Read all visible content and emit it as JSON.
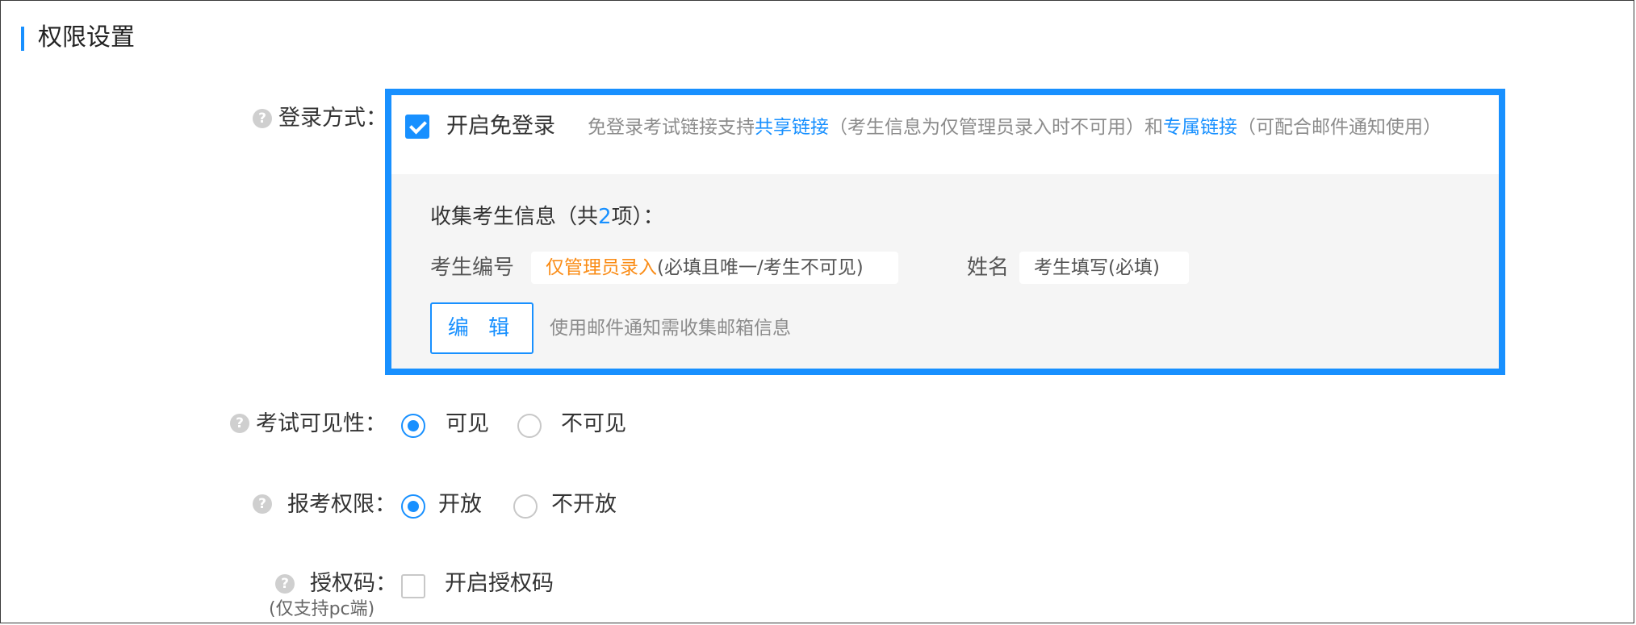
{
  "section": {
    "title": "权限设置"
  },
  "colors": {
    "accent": "#1890ff",
    "orange": "#fa8c16",
    "panel_bg": "#f5f5f5"
  },
  "login": {
    "label": "登录方式：",
    "checkbox_label": "开启免登录",
    "checked": true,
    "hint": {
      "part1": "免登录考试链接支持",
      "link1": "共享链接",
      "part2": "（考生信息为仅管理员录入时不可用）和",
      "link2": "专属链接",
      "part3": "（可配合邮件通知使用）"
    },
    "collect": {
      "title_prefix": "收集考生信息（共",
      "count": "2",
      "title_suffix": "项）：",
      "fields": [
        {
          "label": "考生编号",
          "value_accent": "仅管理员录入",
          "value_rest": "(必填且唯一/考生不可见)"
        },
        {
          "label": "姓名",
          "value_accent": "",
          "value_rest": "考生填写(必填)"
        }
      ],
      "edit_button": "编 辑",
      "edit_hint": "使用邮件通知需收集邮箱信息"
    }
  },
  "visibility": {
    "label": "考试可见性：",
    "options": [
      {
        "label": "可见",
        "selected": true
      },
      {
        "label": "不可见",
        "selected": false
      }
    ]
  },
  "permission": {
    "label": "报考权限：",
    "options": [
      {
        "label": "开放",
        "selected": true
      },
      {
        "label": "不开放",
        "selected": false
      }
    ]
  },
  "auth_code": {
    "label": "授权码：",
    "sublabel": "(仅支持pc端)",
    "checkbox_label": "开启授权码",
    "checked": false
  },
  "icons": {
    "help": "question-circle-icon",
    "checkbox": "check-icon"
  }
}
